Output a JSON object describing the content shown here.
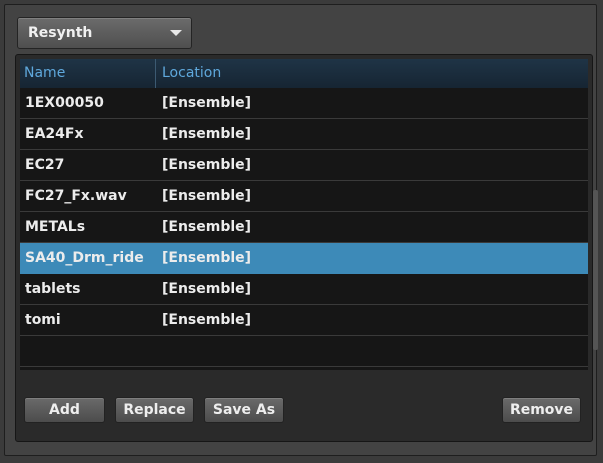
{
  "selector": {
    "value": "Resynth"
  },
  "table": {
    "columns": {
      "name": "Name",
      "location": "Location"
    },
    "rows": [
      {
        "name": "1EX00050",
        "location": "[Ensemble]"
      },
      {
        "name": "EA24Fx",
        "location": "[Ensemble]"
      },
      {
        "name": "EC27",
        "location": "[Ensemble]"
      },
      {
        "name": "FC27_Fx.wav",
        "location": "[Ensemble]"
      },
      {
        "name": "METALs",
        "location": "[Ensemble]"
      },
      {
        "name": "SA40_Drm_ride",
        "location": "[Ensemble]"
      },
      {
        "name": "tablets",
        "location": "[Ensemble]"
      },
      {
        "name": "tomi",
        "location": "[Ensemble]"
      }
    ],
    "selected_index": 5
  },
  "buttons": {
    "add": "Add",
    "replace": "Replace",
    "save_as": "Save As",
    "remove": "Remove"
  },
  "colors": {
    "selection": "#3d8ab8",
    "header_text": "#5fa8dc"
  }
}
